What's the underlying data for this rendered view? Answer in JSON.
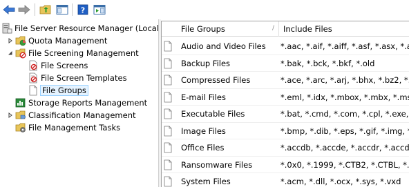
{
  "toolbar": {
    "buttons": [
      {
        "icon": "back-arrow-icon"
      },
      {
        "icon": "forward-arrow-icon"
      },
      {
        "icon": "folder-up-icon"
      },
      {
        "icon": "show-hide-console-tree-icon"
      },
      {
        "icon": "help-icon"
      },
      {
        "icon": "show-hide-action-pane-icon"
      }
    ]
  },
  "tree": {
    "root": "File Server Resource Manager (Local)",
    "items": [
      {
        "label": "Quota Management"
      },
      {
        "label": "File Screening Management"
      },
      {
        "label": "File Screens"
      },
      {
        "label": "File Screen Templates"
      },
      {
        "label": "File Groups"
      },
      {
        "label": "Storage Reports Management"
      },
      {
        "label": "Classification Management"
      },
      {
        "label": "File Management Tasks"
      }
    ]
  },
  "list": {
    "columns": [
      "File Groups",
      "Include Files"
    ],
    "rows": [
      {
        "name": "Audio and Video Files",
        "include": "*.aac, *.aif, *.aiff, *.asf, *.asx, *.au, *.a"
      },
      {
        "name": "Backup Files",
        "include": "*.bak, *.bck, *.bkf, *.old"
      },
      {
        "name": "Compressed Files",
        "include": "*.ace, *.arc, *.arj, *.bhx, *.bz2, *.cab, *.g"
      },
      {
        "name": "E-mail Files",
        "include": "*.eml, *.idx, *.mbox, *.mbx, *.msg, *.ost, *"
      },
      {
        "name": "Executable Files",
        "include": "*.bat, *.cmd, *.com, *.cpl, *.exe, *.inf, *.j"
      },
      {
        "name": "Image Files",
        "include": "*.bmp, *.dib, *.eps, *.gif, *.img, *.jfif, *.jp"
      },
      {
        "name": "Office Files",
        "include": "*.accdb, *.accde, *.accdr, *.accdt, *.adn, *."
      },
      {
        "name": "Ransomware Files",
        "include": "*.0x0, *.1999, *.CTB2, *.CTBL, *.EnCiPhEr"
      },
      {
        "name": "System Files",
        "include": "*.acm, *.dll, *.ocx, *.sys, *.vxd"
      }
    ]
  }
}
